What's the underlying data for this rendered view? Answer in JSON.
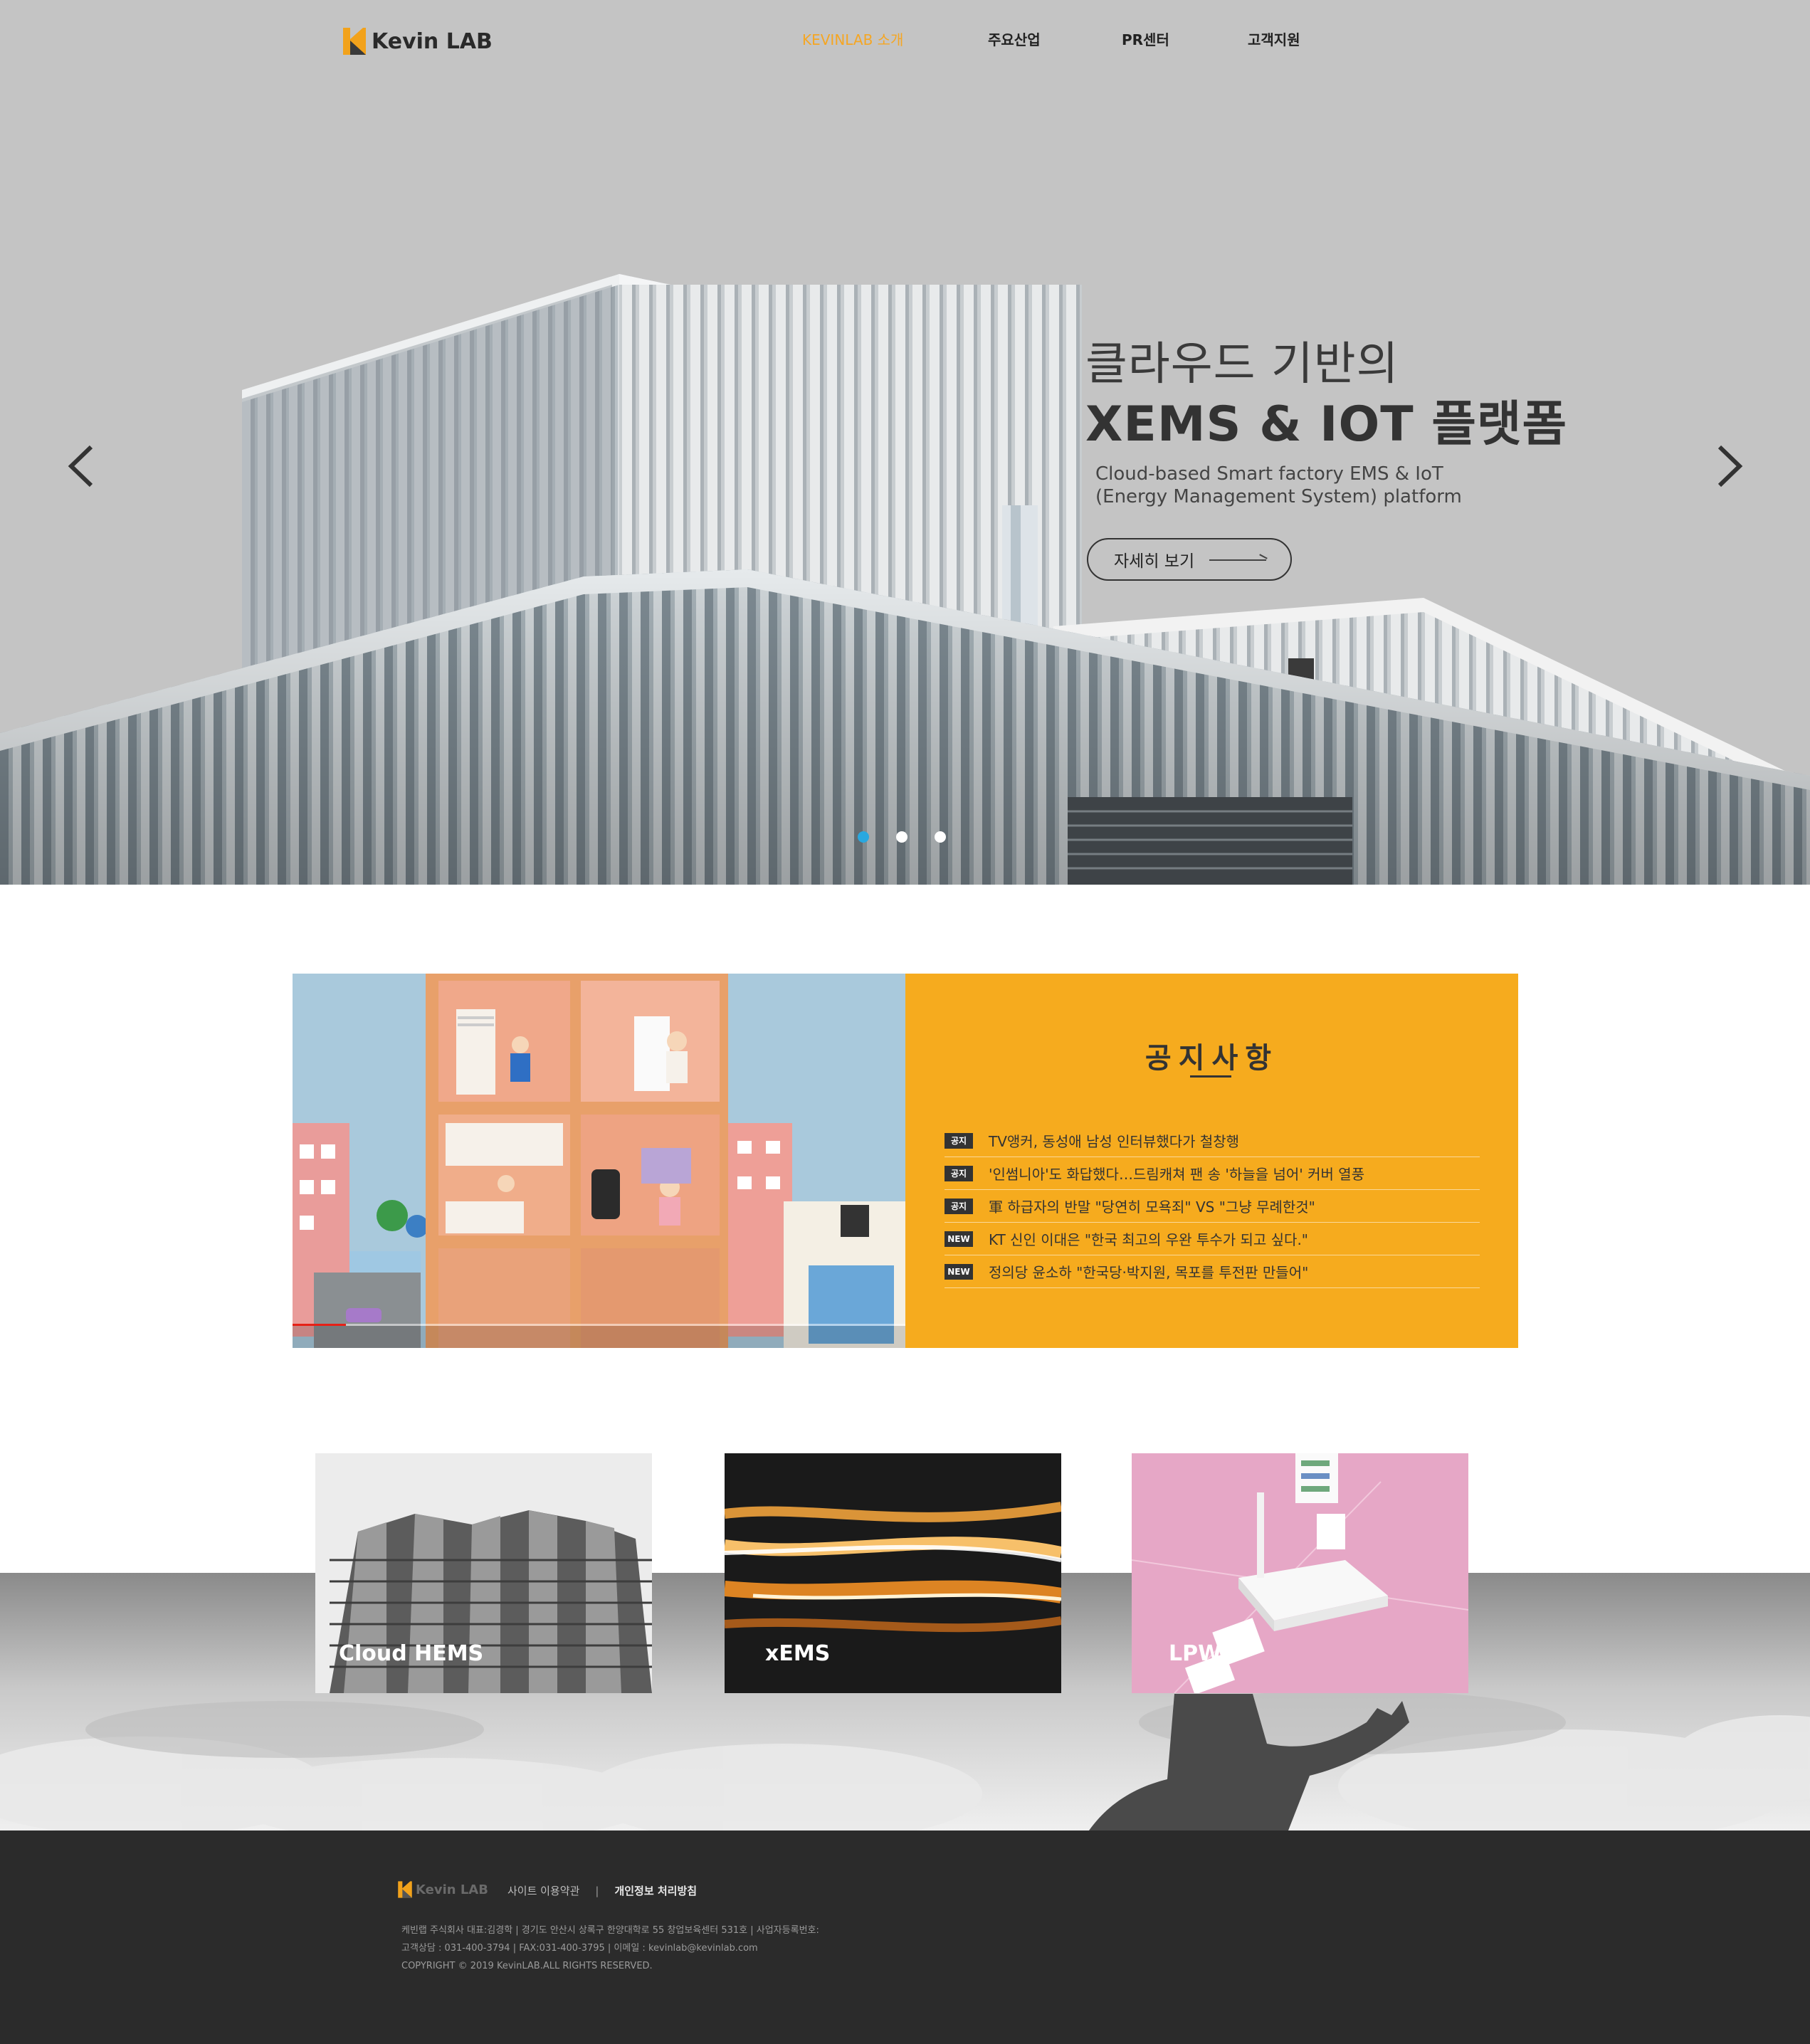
{
  "header": {
    "logo_text": "Kevin LAB",
    "nav": [
      {
        "label": "KEVINLAB 소개",
        "active": true
      },
      {
        "label": "주요산업",
        "active": false
      },
      {
        "label": "PR센터",
        "active": false
      },
      {
        "label": "고객지원",
        "active": false
      }
    ]
  },
  "hero": {
    "line1": "클라우드 기반의",
    "line2": "XEMS & IOT 플랫폼",
    "sub1": "Cloud-based Smart factory EMS &  IoT",
    "sub2": "(Energy Management System) platform",
    "button_label": "자세히 보기",
    "slides": 3,
    "active_slide": 1,
    "icons": {
      "prev": "chevron-left-icon",
      "next": "chevron-right-icon"
    }
  },
  "notice": {
    "title": "공지사항",
    "items": [
      {
        "badge": "공지",
        "text": "TV앵커, 동성애 남성 인터뷰했다가 철창행"
      },
      {
        "badge": "공지",
        "text": "'인썸니아'도 화답했다…드림캐쳐 팬 송 '하늘을 넘어' 커버 열풍"
      },
      {
        "badge": "공지",
        "text": "軍 하급자의 반말 \"당연히 모욕죄\" VS \"그냥 무례한것\""
      },
      {
        "badge": "NEW",
        "text": "KT 신인 이대은 \"한국 최고의 우완 투수가 되고 싶다.\""
      },
      {
        "badge": "NEW",
        "text": "정의당 윤소하 \"한국당·박지원, 목포를 투전판 만들어\""
      }
    ]
  },
  "business": [
    {
      "label": "Cloud HEMS"
    },
    {
      "label": "xEMS"
    },
    {
      "label": "LPWA"
    }
  ],
  "footer": {
    "logo_text": "Kevin LAB",
    "links": [
      "사이트 이용약관",
      "개인정보 처리방침"
    ],
    "info_line1": "케빈랩 주식회사 대표:김경학    |    경기도 안산시 상록구 한양대학로 55 창업보육센터 531호    |    사업자등록번호:",
    "info_line2": "고객상담 : 031-400-3794    |    FAX:031-400-3795    |    이메일 : kevinlab@kevinlab.com",
    "copyright": "COPYRIGHT © 2019 KevinLAB.ALL RIGHTS RESERVED."
  },
  "colors": {
    "accent": "#f6ab1e",
    "nav_active": "#f5a623",
    "dot_active": "#29a8e0",
    "footer_bg": "#2b2b2b"
  }
}
